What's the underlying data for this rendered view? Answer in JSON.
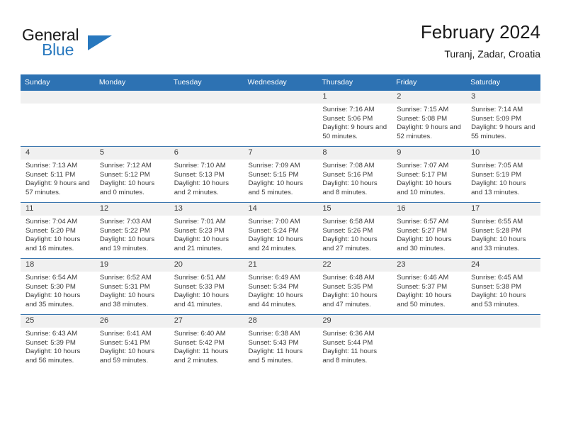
{
  "brand": {
    "word_general": "General",
    "word_blue": "Blue",
    "triangle_icon": "brand-triangle-icon",
    "accent_color": "#2878BE"
  },
  "header": {
    "title": "February 2024",
    "subtitle": "Turanj, Zadar, Croatia"
  },
  "calendar": {
    "header_color": "#2D72B3",
    "daynum_bg": "#F0F0F0",
    "weekday_headers": [
      "Sunday",
      "Monday",
      "Tuesday",
      "Wednesday",
      "Thursday",
      "Friday",
      "Saturday"
    ],
    "weeks": [
      [
        {
          "day": "",
          "sunrise": "",
          "sunset": "",
          "daylight": "",
          "empty": true
        },
        {
          "day": "",
          "sunrise": "",
          "sunset": "",
          "daylight": "",
          "empty": true
        },
        {
          "day": "",
          "sunrise": "",
          "sunset": "",
          "daylight": "",
          "empty": true
        },
        {
          "day": "",
          "sunrise": "",
          "sunset": "",
          "daylight": "",
          "empty": true
        },
        {
          "day": "1",
          "sunrise": "Sunrise: 7:16 AM",
          "sunset": "Sunset: 5:06 PM",
          "daylight": "Daylight: 9 hours and 50 minutes."
        },
        {
          "day": "2",
          "sunrise": "Sunrise: 7:15 AM",
          "sunset": "Sunset: 5:08 PM",
          "daylight": "Daylight: 9 hours and 52 minutes."
        },
        {
          "day": "3",
          "sunrise": "Sunrise: 7:14 AM",
          "sunset": "Sunset: 5:09 PM",
          "daylight": "Daylight: 9 hours and 55 minutes."
        }
      ],
      [
        {
          "day": "4",
          "sunrise": "Sunrise: 7:13 AM",
          "sunset": "Sunset: 5:11 PM",
          "daylight": "Daylight: 9 hours and 57 minutes."
        },
        {
          "day": "5",
          "sunrise": "Sunrise: 7:12 AM",
          "sunset": "Sunset: 5:12 PM",
          "daylight": "Daylight: 10 hours and 0 minutes."
        },
        {
          "day": "6",
          "sunrise": "Sunrise: 7:10 AM",
          "sunset": "Sunset: 5:13 PM",
          "daylight": "Daylight: 10 hours and 2 minutes."
        },
        {
          "day": "7",
          "sunrise": "Sunrise: 7:09 AM",
          "sunset": "Sunset: 5:15 PM",
          "daylight": "Daylight: 10 hours and 5 minutes."
        },
        {
          "day": "8",
          "sunrise": "Sunrise: 7:08 AM",
          "sunset": "Sunset: 5:16 PM",
          "daylight": "Daylight: 10 hours and 8 minutes."
        },
        {
          "day": "9",
          "sunrise": "Sunrise: 7:07 AM",
          "sunset": "Sunset: 5:17 PM",
          "daylight": "Daylight: 10 hours and 10 minutes."
        },
        {
          "day": "10",
          "sunrise": "Sunrise: 7:05 AM",
          "sunset": "Sunset: 5:19 PM",
          "daylight": "Daylight: 10 hours and 13 minutes."
        }
      ],
      [
        {
          "day": "11",
          "sunrise": "Sunrise: 7:04 AM",
          "sunset": "Sunset: 5:20 PM",
          "daylight": "Daylight: 10 hours and 16 minutes."
        },
        {
          "day": "12",
          "sunrise": "Sunrise: 7:03 AM",
          "sunset": "Sunset: 5:22 PM",
          "daylight": "Daylight: 10 hours and 19 minutes."
        },
        {
          "day": "13",
          "sunrise": "Sunrise: 7:01 AM",
          "sunset": "Sunset: 5:23 PM",
          "daylight": "Daylight: 10 hours and 21 minutes."
        },
        {
          "day": "14",
          "sunrise": "Sunrise: 7:00 AM",
          "sunset": "Sunset: 5:24 PM",
          "daylight": "Daylight: 10 hours and 24 minutes."
        },
        {
          "day": "15",
          "sunrise": "Sunrise: 6:58 AM",
          "sunset": "Sunset: 5:26 PM",
          "daylight": "Daylight: 10 hours and 27 minutes."
        },
        {
          "day": "16",
          "sunrise": "Sunrise: 6:57 AM",
          "sunset": "Sunset: 5:27 PM",
          "daylight": "Daylight: 10 hours and 30 minutes."
        },
        {
          "day": "17",
          "sunrise": "Sunrise: 6:55 AM",
          "sunset": "Sunset: 5:28 PM",
          "daylight": "Daylight: 10 hours and 33 minutes."
        }
      ],
      [
        {
          "day": "18",
          "sunrise": "Sunrise: 6:54 AM",
          "sunset": "Sunset: 5:30 PM",
          "daylight": "Daylight: 10 hours and 35 minutes."
        },
        {
          "day": "19",
          "sunrise": "Sunrise: 6:52 AM",
          "sunset": "Sunset: 5:31 PM",
          "daylight": "Daylight: 10 hours and 38 minutes."
        },
        {
          "day": "20",
          "sunrise": "Sunrise: 6:51 AM",
          "sunset": "Sunset: 5:33 PM",
          "daylight": "Daylight: 10 hours and 41 minutes."
        },
        {
          "day": "21",
          "sunrise": "Sunrise: 6:49 AM",
          "sunset": "Sunset: 5:34 PM",
          "daylight": "Daylight: 10 hours and 44 minutes."
        },
        {
          "day": "22",
          "sunrise": "Sunrise: 6:48 AM",
          "sunset": "Sunset: 5:35 PM",
          "daylight": "Daylight: 10 hours and 47 minutes."
        },
        {
          "day": "23",
          "sunrise": "Sunrise: 6:46 AM",
          "sunset": "Sunset: 5:37 PM",
          "daylight": "Daylight: 10 hours and 50 minutes."
        },
        {
          "day": "24",
          "sunrise": "Sunrise: 6:45 AM",
          "sunset": "Sunset: 5:38 PM",
          "daylight": "Daylight: 10 hours and 53 minutes."
        }
      ],
      [
        {
          "day": "25",
          "sunrise": "Sunrise: 6:43 AM",
          "sunset": "Sunset: 5:39 PM",
          "daylight": "Daylight: 10 hours and 56 minutes."
        },
        {
          "day": "26",
          "sunrise": "Sunrise: 6:41 AM",
          "sunset": "Sunset: 5:41 PM",
          "daylight": "Daylight: 10 hours and 59 minutes."
        },
        {
          "day": "27",
          "sunrise": "Sunrise: 6:40 AM",
          "sunset": "Sunset: 5:42 PM",
          "daylight": "Daylight: 11 hours and 2 minutes."
        },
        {
          "day": "28",
          "sunrise": "Sunrise: 6:38 AM",
          "sunset": "Sunset: 5:43 PM",
          "daylight": "Daylight: 11 hours and 5 minutes."
        },
        {
          "day": "29",
          "sunrise": "Sunrise: 6:36 AM",
          "sunset": "Sunset: 5:44 PM",
          "daylight": "Daylight: 11 hours and 8 minutes."
        },
        {
          "day": "",
          "sunrise": "",
          "sunset": "",
          "daylight": "",
          "empty": true
        },
        {
          "day": "",
          "sunrise": "",
          "sunset": "",
          "daylight": "",
          "empty": true
        }
      ]
    ]
  }
}
